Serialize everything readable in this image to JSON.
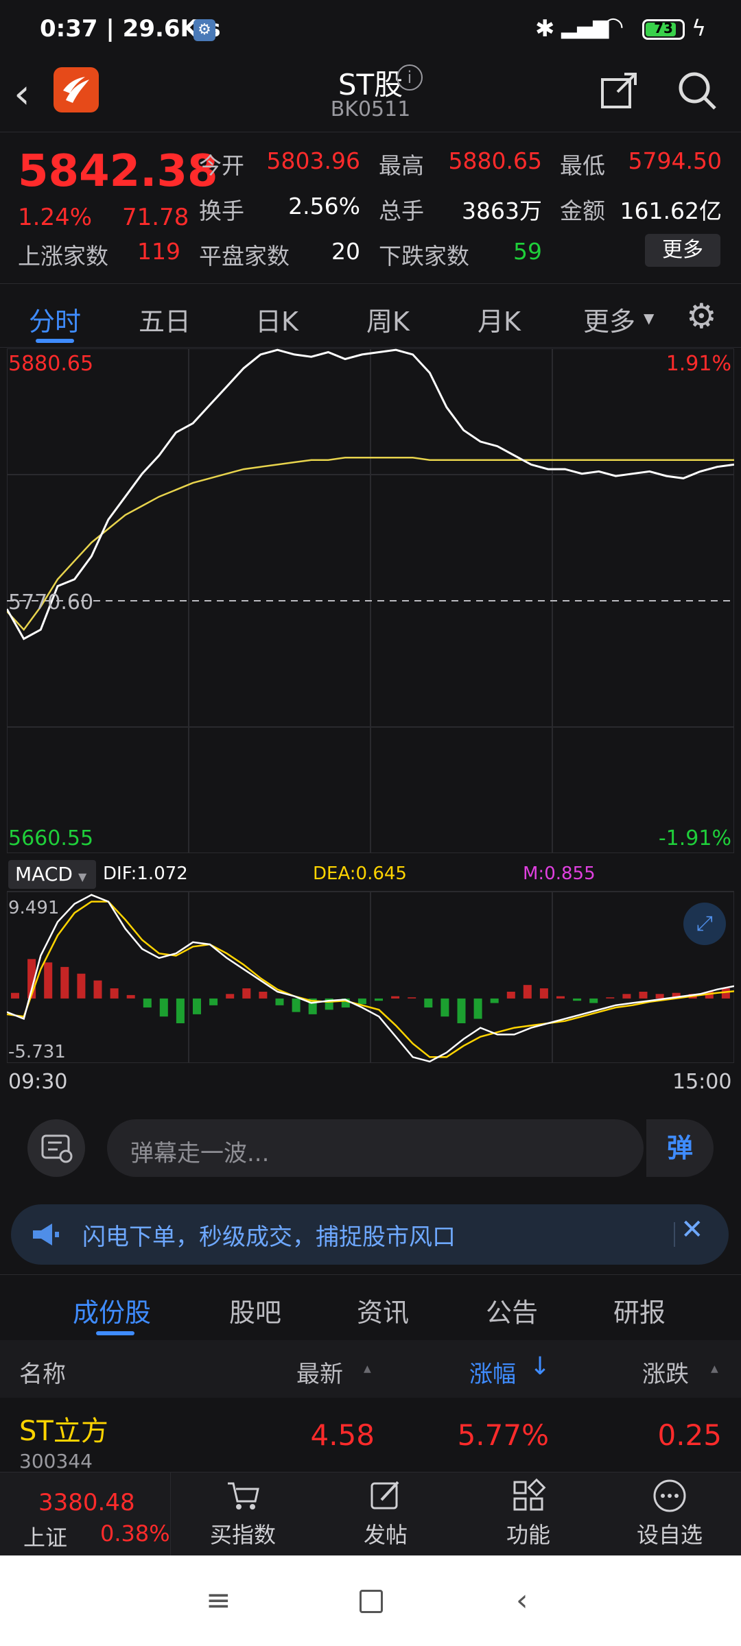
{
  "status_bar": {
    "time": "0:37 | 29.6K/s",
    "battery": "73"
  },
  "header": {
    "title": "ST股",
    "code": "BK0511"
  },
  "quote": {
    "price": "5842.38",
    "change_pct": "1.24%",
    "change": "71.78",
    "rising_label": "上涨家数",
    "rising": "119",
    "open_label": "今开",
    "open": "5803.96",
    "high_label": "最高",
    "high": "5880.65",
    "low_label": "最低",
    "low": "5794.50",
    "turnover_label": "换手",
    "turnover": "2.56%",
    "volume_label": "总手",
    "volume": "3863万",
    "amount_label": "金额",
    "amount": "161.62亿",
    "flat_label": "平盘家数",
    "flat": "20",
    "falling_label": "下跌家数",
    "falling": "59",
    "more_label": "更多"
  },
  "tabs": [
    "分时",
    "五日",
    "日K",
    "周K",
    "月K",
    "更多"
  ],
  "chart_data": [
    {
      "type": "line",
      "x_start": "09:30",
      "x_end": "15:00",
      "ylim": [
        5660.55,
        5880.65
      ],
      "y_ref": 5770.6,
      "y_top_label": "5880.65",
      "y_mid_label": "5770.60",
      "y_bottom_label": "5660.55",
      "pct_top_label": "1.91%",
      "pct_bottom_label": "-1.91%",
      "series": [
        {
          "values": [
            5767,
            5754,
            5758,
            5777,
            5780,
            5790,
            5806,
            5816,
            5826,
            5834,
            5844,
            5848,
            5856,
            5864,
            5872,
            5878,
            5880,
            5878,
            5877,
            5879,
            5876,
            5878,
            5879,
            5880,
            5878,
            5870,
            5855,
            5845,
            5840,
            5838,
            5834,
            5830,
            5828,
            5828,
            5826,
            5827,
            5825,
            5826,
            5827,
            5825,
            5824,
            5827,
            5829,
            5830
          ]
        },
        {
          "values": [
            5766,
            5758,
            5768,
            5780,
            5788,
            5796,
            5802,
            5808,
            5812,
            5816,
            5819,
            5822,
            5824,
            5826,
            5828,
            5829,
            5830,
            5831,
            5832,
            5832,
            5833,
            5833,
            5833,
            5833,
            5833,
            5832,
            5832,
            5832,
            5832,
            5832,
            5832,
            5832,
            5832,
            5832,
            5832,
            5832,
            5832,
            5832,
            5832,
            5832,
            5832,
            5832,
            5832,
            5832
          ]
        }
      ]
    },
    {
      "type": "bar",
      "indicator": "MACD",
      "dif_label": "DIF:1.072",
      "dea_label": "DEA:0.645",
      "m_label": "M:0.855",
      "y_top_label": "9.491",
      "y_bottom_label": "-5.731",
      "ylim": [
        -5.731,
        9.491
      ],
      "histogram": [
        0.5,
        3.5,
        3.2,
        2.8,
        2.2,
        1.6,
        0.9,
        0.3,
        -0.8,
        -1.6,
        -2.2,
        -1.4,
        -0.6,
        0.4,
        0.9,
        0.6,
        -0.6,
        -1.2,
        -1.4,
        -1.0,
        -0.8,
        -0.5,
        -0.2,
        0.2,
        0.1,
        -0.8,
        -1.6,
        -2.2,
        -1.8,
        -0.4,
        0.6,
        1.2,
        0.9,
        0.2,
        -0.2,
        -0.4,
        0.1,
        0.4,
        0.6,
        0.4,
        0.5,
        0.4,
        0.6,
        0.9
      ],
      "dif": [
        -1.2,
        -1.8,
        3.8,
        6.8,
        8.4,
        9.2,
        8.6,
        6.2,
        4.4,
        3.6,
        4.0,
        5.0,
        4.8,
        3.6,
        2.6,
        1.6,
        0.6,
        0.2,
        -0.4,
        -0.2,
        -0.1,
        -0.8,
        -1.6,
        -3.4,
        -5.2,
        -5.6,
        -4.8,
        -3.6,
        -2.6,
        -3.2,
        -3.2,
        -2.6,
        -2.2,
        -1.8,
        -1.4,
        -1.0,
        -0.6,
        -0.4,
        -0.2,
        0.0,
        0.2,
        0.4,
        0.8,
        1.1
      ],
      "dea": [
        -1.4,
        -1.6,
        2.6,
        5.6,
        7.6,
        8.6,
        8.6,
        7.0,
        5.2,
        4.0,
        3.8,
        4.6,
        4.8,
        4.0,
        3.0,
        1.8,
        0.8,
        0.2,
        -0.2,
        -0.3,
        -0.2,
        -0.6,
        -1.0,
        -2.4,
        -4.0,
        -5.2,
        -5.2,
        -4.2,
        -3.4,
        -3.0,
        -2.6,
        -2.4,
        -2.2,
        -2.0,
        -1.6,
        -1.2,
        -0.8,
        -0.6,
        -0.3,
        -0.1,
        0.1,
        0.3,
        0.5,
        0.65
      ]
    }
  ],
  "comment": {
    "placeholder": "弹幕走一波...",
    "button": "弹"
  },
  "banner": {
    "text": "闪电下单，秒级成交，捕捉股市风口"
  },
  "subtabs": [
    "成份股",
    "股吧",
    "资讯",
    "公告",
    "研报"
  ],
  "table": {
    "headers": {
      "name": "名称",
      "latest": "最新",
      "change_pct": "涨幅",
      "change": "涨跌"
    },
    "rows": [
      {
        "name": "ST立方",
        "code": "300344",
        "latest": "4.58",
        "change_pct": "5.77%",
        "change": "0.25"
      }
    ]
  },
  "bottom_bar": {
    "index_value": "3380.48",
    "index_name": "上证",
    "index_pct": "0.38%",
    "items": [
      "买指数",
      "发帖",
      "功能",
      "设自选"
    ]
  },
  "colors": {
    "up": "#ff2b2b",
    "down": "#1fcf3a",
    "accent": "#3f8cff",
    "price_line": "#ffffff",
    "avg_line": "#e8d44d"
  }
}
